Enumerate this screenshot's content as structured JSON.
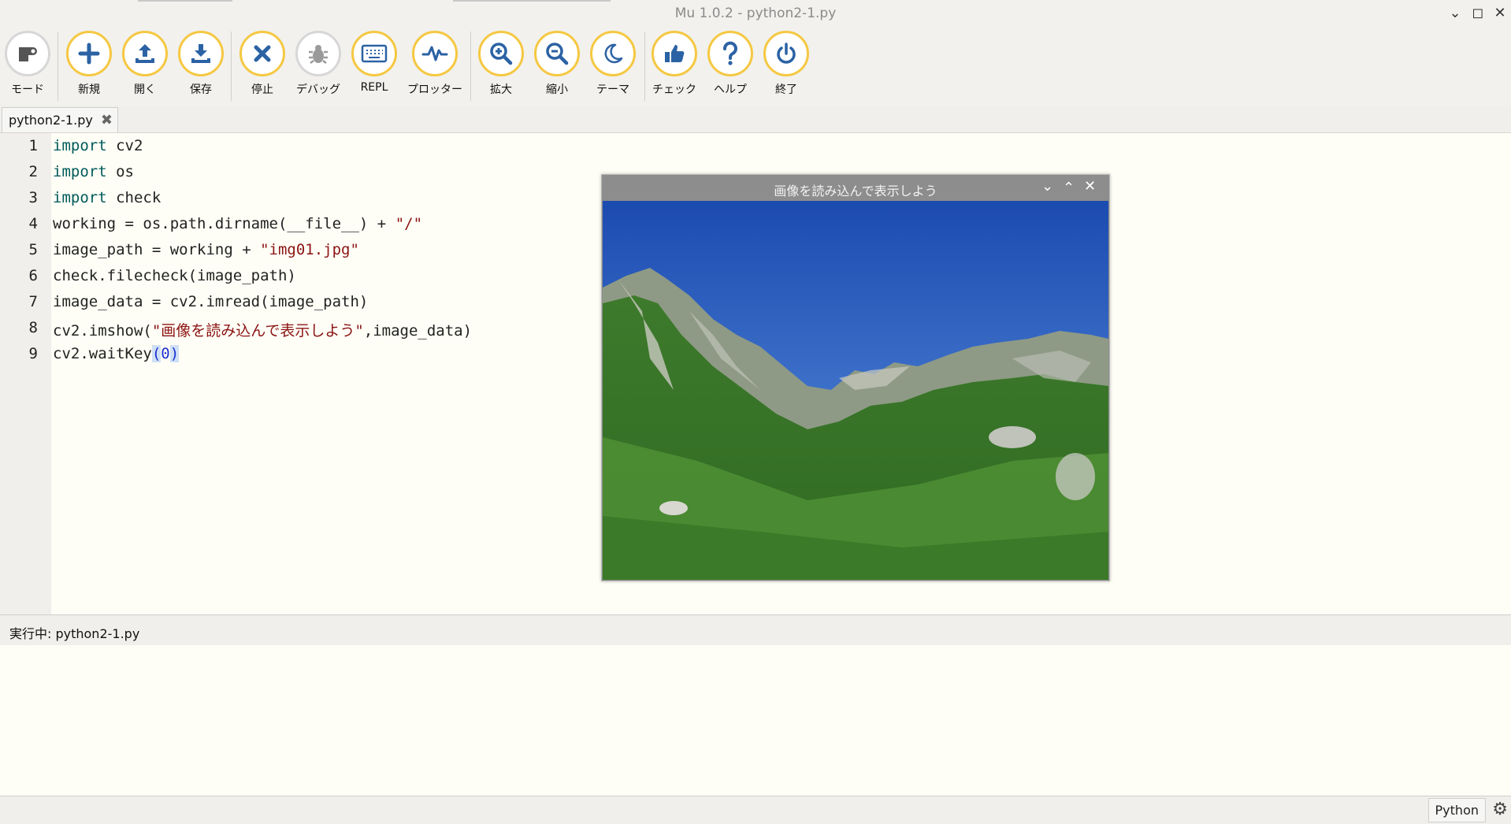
{
  "window": {
    "title": "Mu 1.0.2 - python2-1.py"
  },
  "toolbar": {
    "mode": "モード",
    "new": "新規",
    "open": "開く",
    "save": "保存",
    "stop": "停止",
    "debug": "デバッグ",
    "repl": "REPL",
    "plotter": "プロッター",
    "zoom_in": "拡大",
    "zoom_out": "縮小",
    "theme": "テーマ",
    "check": "チェック",
    "help": "ヘルプ",
    "quit": "終了"
  },
  "tab": {
    "filename": "python2-1.py"
  },
  "editor": {
    "line_numbers": [
      "1",
      "2",
      "3",
      "4",
      "5",
      "6",
      "7",
      "8",
      "9"
    ],
    "lines": {
      "l1_kw": "import",
      "l1_rest": " cv2",
      "l2_kw": "import",
      "l2_rest": " os",
      "l3_kw": "import",
      "l3_rest": " check",
      "l4_code": "working = os.path.dirname(__file__) + ",
      "l4_str": "\"/\"",
      "l5_code": "image_path = working + ",
      "l5_str": "\"img01.jpg\"",
      "l6_code": "check.filecheck(image_path)",
      "l7_code": "image_data = cv2.imread(image_path)",
      "l8_pre": "cv2.imshow(",
      "l8_str": "\"画像を読み込んで表示しよう\"",
      "l8_post": ",image_data)",
      "l9_pre": "cv2.waitKey",
      "l9_open": "(",
      "l9_num": "0",
      "l9_close": ")"
    }
  },
  "image_window": {
    "title": "画像を読み込んで表示しよう"
  },
  "output": {
    "header": "実行中: python2-1.py"
  },
  "statusbar": {
    "mode": "Python"
  },
  "colors": {
    "accent": "#f5c842",
    "icon": "#2b62a4",
    "editor_bg": "#fefef6"
  },
  "icons": [
    "mode-icon",
    "plus-icon",
    "upload-icon",
    "download-icon",
    "close-icon",
    "bug-icon",
    "keyboard-icon",
    "pulse-icon",
    "zoom-in-icon",
    "zoom-out-icon",
    "moon-icon",
    "thumbs-up-icon",
    "question-icon",
    "power-icon",
    "gear-icon"
  ]
}
